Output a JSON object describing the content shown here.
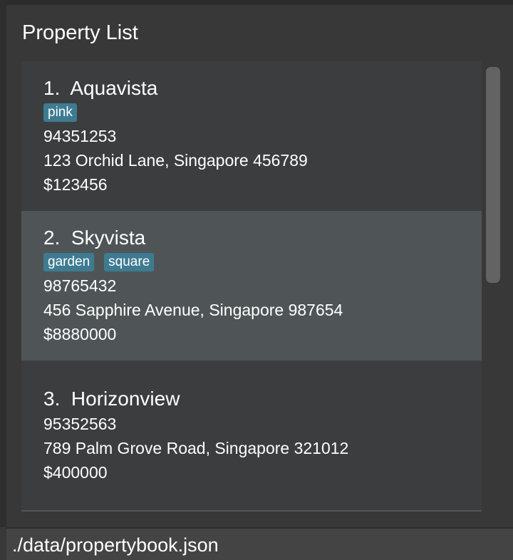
{
  "panel": {
    "title": "Property List"
  },
  "properties": [
    {
      "index": "1.",
      "name": "Aquavista",
      "tags": [
        "pink"
      ],
      "phone": "94351253",
      "address": "123 Orchid Lane, Singapore 456789",
      "price": "$123456"
    },
    {
      "index": "2.",
      "name": "Skyvista",
      "tags": [
        "garden",
        "square"
      ],
      "phone": "98765432",
      "address": "456 Sapphire Avenue, Singapore 987654",
      "price": "$8880000",
      "selected": true
    },
    {
      "index": "3.",
      "name": "Horizonview",
      "tags": [],
      "phone": "95352563",
      "address": "789 Palm Grove Road, Singapore 321012",
      "price": "$400000"
    }
  ],
  "status": {
    "file_path": "./data/propertybook.json"
  },
  "colors": {
    "tag": "#3e7b91",
    "selected": "#4f5557",
    "card": "#3c3d3f"
  }
}
